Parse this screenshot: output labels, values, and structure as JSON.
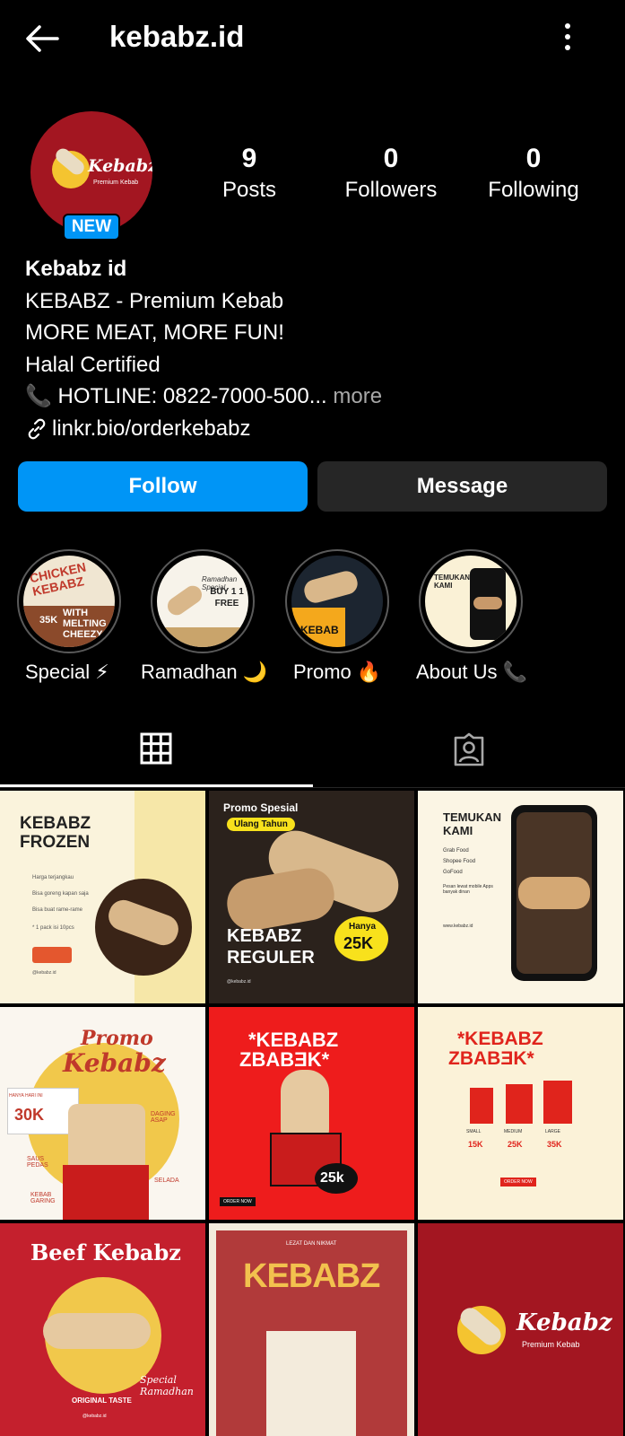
{
  "header": {
    "username": "kebabz.id",
    "back_icon": "arrow-left-icon",
    "menu_icon": "more-vertical-icon"
  },
  "profile": {
    "avatar_logo_text": "Kebabz",
    "avatar_logo_sub": "Premium Kebab",
    "new_badge": "NEW",
    "stats": {
      "posts": {
        "value": "9",
        "label": "Posts"
      },
      "followers": {
        "value": "0",
        "label": "Followers"
      },
      "following": {
        "value": "0",
        "label": "Following"
      }
    }
  },
  "bio": {
    "name": "Kebabz id",
    "line1": "KEBABZ - Premium Kebab",
    "line2": "MORE MEAT, MORE FUN!",
    "line3": "Halal Certified",
    "line4": "📞 HOTLINE: 0822-7000-500...",
    "more": " more",
    "link": "linkr.bio/orderkebabz"
  },
  "actions": {
    "follow": "Follow",
    "message": "Message"
  },
  "highlights": [
    {
      "label": "Special ⚡"
    },
    {
      "label": "Ramadhan 🌙"
    },
    {
      "label": "Promo 🔥"
    },
    {
      "label": "About Us 📞"
    }
  ],
  "highlight_texts": {
    "h1_top": "CHICKEN KEBABZ",
    "h1_bottom": "WITH MELTING CHEEZY",
    "h1_price": "35K",
    "h2_title": "Ramadhan Special",
    "h2_offer": "BUY 1 1 FREE",
    "h3_title": "KEBAB",
    "h4_title": "TEMUKAN KAMI"
  },
  "tabs": {
    "posts_icon": "grid-icon",
    "tagged_icon": "tagged-person-icon"
  },
  "posts": [
    {
      "title": "KEBABZ FROZEN",
      "lines": [
        "Harga terjangkau",
        "Bisa goreng kapan saja",
        "Bisa buat rame-rame",
        "* 1 pack isi 10pcs"
      ],
      "footer": "@kebabz.id"
    },
    {
      "badge": "Promo Spesial",
      "tag": "Ulang Tahun",
      "title": "KEBABZ REGULER",
      "price_label": "Hanya",
      "price": "25K",
      "footer": "@kebabz.id"
    },
    {
      "title": "TEMUKAN KAMI",
      "lines": [
        "Grab Food",
        "Shopee Food",
        "GoFood",
        "Pesan lewat mobile Apps banyak dinan"
      ],
      "footer": "www.kebabz.id"
    },
    {
      "title": "Promo",
      "subtitle": "Kebabz",
      "price_label": "HANYA HARI INI",
      "price": "30K",
      "labels": [
        "DAGING ASAP",
        "SAUS PEDAS",
        "SELADA",
        "KEBAB GARING"
      ]
    },
    {
      "title": "*KEBABZ",
      "mirror": "ZBABƎK*",
      "price": "25k",
      "cta": "ORDER NOW"
    },
    {
      "title": "*KEBABZ",
      "mirror": "ZBABƎK*",
      "sizes": [
        "SMALL",
        "MEDIUM",
        "LARGE"
      ],
      "prices": [
        "15K",
        "25K",
        "35K"
      ],
      "cta": "ORDER NOW"
    },
    {
      "title": "Beef Kebabz",
      "taste": "ORIGINAL TASTE",
      "special": "Special Ramadhan",
      "footer": "@kebabz.id"
    },
    {
      "top": "LEZAT DAN NIKMAT",
      "title": "KEBABZ"
    },
    {
      "title": "Kebabz",
      "subtitle": "Premium Kebab"
    }
  ],
  "colors": {
    "background": "#000000",
    "accent_blue": "#0095f6",
    "button_dark": "#262626",
    "brand_red": "#a31621",
    "brand_yellow": "#f4c430",
    "muted_text": "#a8a8a8"
  }
}
